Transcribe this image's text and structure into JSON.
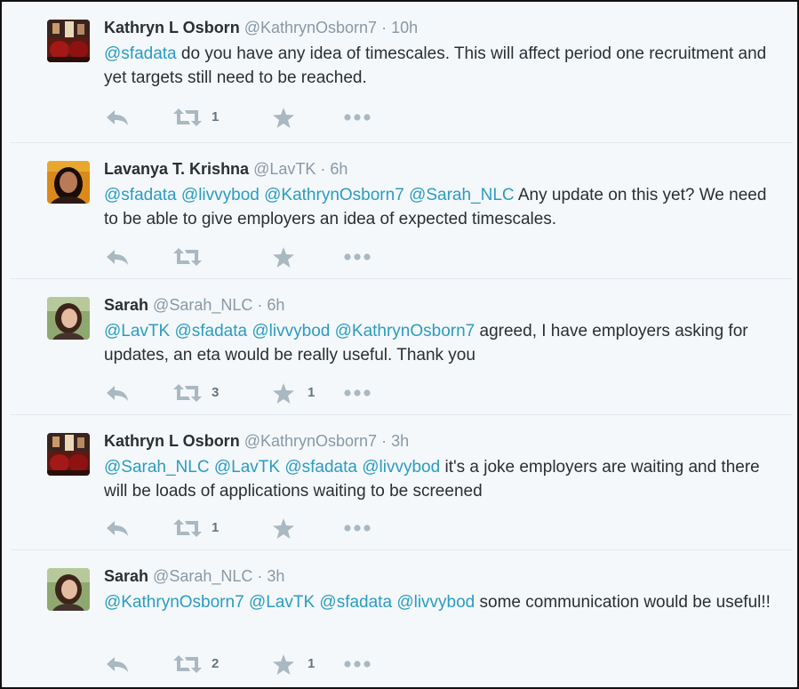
{
  "colors": {
    "mention": "#2a9cc0",
    "icon": "#aab8c2",
    "name": "#292f33",
    "meta": "#8899a6",
    "background": "#f5f8fa"
  },
  "tweets": [
    {
      "name": "Kathryn L Osborn",
      "handle": "@KathrynOsborn7",
      "separator": "·",
      "time": "10h",
      "avatar": "kathryn-avatar",
      "mentions": [
        "@sfadata"
      ],
      "body": "do you have any idea of timescales. This will affect period one recruitment and yet targets still need to be reached.",
      "retweets": "1",
      "favorites": ""
    },
    {
      "name": "Lavanya T. Krishna",
      "handle": "@LavTK",
      "separator": "·",
      "time": "6h",
      "avatar": "lavanya-avatar",
      "mentions": [
        "@sfadata",
        "@livvybod",
        "@KathrynOsborn7",
        "@Sarah_NLC"
      ],
      "body": "Any update on this yet? We need to be able to give employers an idea of expected timescales.",
      "retweets": "",
      "favorites": ""
    },
    {
      "name": "Sarah",
      "handle": "@Sarah_NLC",
      "separator": "·",
      "time": "6h",
      "avatar": "sarah-avatar",
      "mentions": [
        "@LavTK",
        "@sfadata",
        "@livvybod",
        "@KathrynOsborn7"
      ],
      "body": "agreed, I have employers asking for updates, an eta would be really useful. Thank you",
      "retweets": "3",
      "favorites": "1"
    },
    {
      "name": "Kathryn L Osborn",
      "handle": "@KathrynOsborn7",
      "separator": "·",
      "time": "3h",
      "avatar": "kathryn-avatar",
      "mentions": [
        "@Sarah_NLC",
        "@LavTK",
        "@sfadata",
        "@livvybod"
      ],
      "body": "it's a joke employers are waiting and there will be loads of applications waiting to be screened",
      "retweets": "1",
      "favorites": ""
    },
    {
      "name": "Sarah",
      "handle": "@Sarah_NLC",
      "separator": "·",
      "time": "3h",
      "avatar": "sarah-avatar",
      "mentions": [
        "@KathrynOsborn7",
        "@LavTK",
        "@sfadata",
        "@livvybod"
      ],
      "body": "some communication would be useful!!",
      "retweets": "2",
      "favorites": "1"
    }
  ]
}
